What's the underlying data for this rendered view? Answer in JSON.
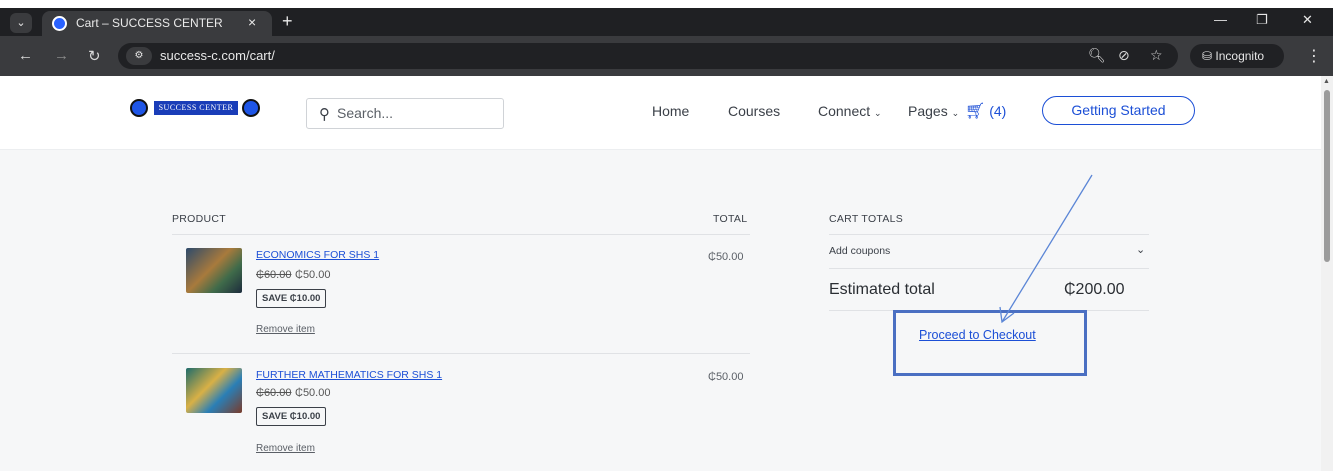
{
  "browser": {
    "tab_title": "Cart – SUCCESS CENTER",
    "tab_close": "×",
    "new_tab": "+",
    "url": "success-c.com/cart/",
    "incognito_label": "Incognito",
    "icons": [
      "tab-search-icon",
      "favicon-icon",
      "close-icon",
      "back-icon",
      "forward-icon",
      "reload-icon",
      "site-info-icon",
      "zoom-icon",
      "eye-off-icon",
      "star-icon",
      "incognito-icon",
      "more-icon",
      "minimize-icon",
      "restore-icon",
      "window-close-icon"
    ]
  },
  "header": {
    "logo_text": "SUCCESS CENTER",
    "search_placeholder": "Search...",
    "nav": [
      "Home",
      "Courses",
      "Connect",
      "Pages"
    ],
    "cart_count": "(4)",
    "cta_label": "Getting Started"
  },
  "cart": {
    "col_product": "PRODUCT",
    "col_total": "TOTAL",
    "items": [
      {
        "name": "ECONOMICS FOR SHS 1",
        "old_price": "₵60.00",
        "price": "₵50.00",
        "save": "SAVE ₵10.00",
        "remove": "Remove item",
        "total": "₵50.00"
      },
      {
        "name": "FURTHER MATHEMATICS FOR SHS 1",
        "old_price": "₵60.00",
        "price": "₵50.00",
        "save": "SAVE ₵10.00",
        "remove": "Remove item",
        "total": "₵50.00"
      }
    ]
  },
  "totals": {
    "title": "CART TOTALS",
    "coupons": "Add coupons",
    "estimated_label": "Estimated total",
    "estimated_value": "₵200.00",
    "checkout_label": "Proceed to Checkout"
  },
  "annotation_color": "#4a6fc2"
}
